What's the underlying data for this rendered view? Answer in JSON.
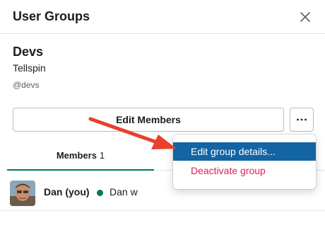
{
  "header": {
    "title": "User Groups",
    "close_icon": "close-icon"
  },
  "group": {
    "name": "Devs",
    "team": "Tellspin",
    "handle": "@devs"
  },
  "actions": {
    "edit_members_label": "Edit Members",
    "more_icon": "more-horizontal-icon",
    "more_label": "···"
  },
  "tabs": {
    "members_label": "Members",
    "members_count": "1"
  },
  "members": [
    {
      "name": "Dan (you)",
      "display_name": "Dan w",
      "status": "active"
    }
  ],
  "menu": {
    "items": [
      {
        "label": "Edit group details...",
        "highlighted": true
      },
      {
        "label": "Deactivate group",
        "danger": true
      }
    ]
  },
  "colors": {
    "accent": "#1264a3",
    "danger": "#e01e5a",
    "tab_underline": "#007a5a",
    "presence": "#007a5a",
    "annotation_arrow": "#e8412c"
  }
}
